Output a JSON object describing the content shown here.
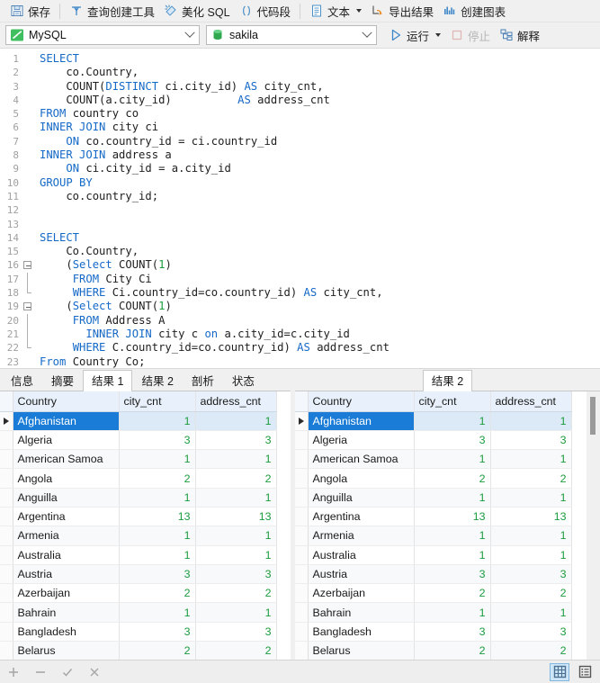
{
  "toolbar": {
    "items": [
      {
        "label": "保存",
        "icon": "save-icon",
        "disabled": false
      },
      {
        "label": "查询创建工具",
        "icon": "query-builder-icon",
        "disabled": false
      },
      {
        "label": "美化 SQL",
        "icon": "beautify-sql-icon",
        "disabled": false
      },
      {
        "label": "代码段",
        "icon": "code-snippet-icon",
        "disabled": false
      },
      {
        "label": "文本",
        "icon": "text-icon",
        "disabled": false
      },
      {
        "label": "导出结果",
        "icon": "export-result-icon",
        "disabled": false
      },
      {
        "label": "创建图表",
        "icon": "create-chart-icon",
        "disabled": false
      }
    ]
  },
  "connection_bar": {
    "connection": {
      "value": "MySQL",
      "icon": "mysql-icon"
    },
    "database": {
      "value": "sakila",
      "icon": "database-icon"
    },
    "run_label": "运行",
    "stop_label": "停止",
    "explain_label": "解释"
  },
  "editor": {
    "lines": [
      {
        "n": 1,
        "html": "<span class='kw'>SELECT</span>"
      },
      {
        "n": 2,
        "html": "    co.Country,"
      },
      {
        "n": 3,
        "html": "    COUNT(<span class='kw'>DISTINCT</span> ci.city_id) <span class='kw'>AS</span> city_cnt,"
      },
      {
        "n": 4,
        "html": "    COUNT(a.city_id)          <span class='kw'>AS</span> address_cnt"
      },
      {
        "n": 5,
        "html": "<span class='kw'>FROM</span> country co"
      },
      {
        "n": 6,
        "html": "<span class='kw'>INNER JOIN</span> city ci"
      },
      {
        "n": 7,
        "html": "    <span class='kw'>ON</span> co.country_id = ci.country_id"
      },
      {
        "n": 8,
        "html": "<span class='kw'>INNER JOIN</span> address a"
      },
      {
        "n": 9,
        "html": "    <span class='kw'>ON</span> ci.city_id = a.city_id"
      },
      {
        "n": 10,
        "html": "<span class='kw'>GROUP BY</span>"
      },
      {
        "n": 11,
        "html": "    co.country_id;"
      },
      {
        "n": 12,
        "html": ""
      },
      {
        "n": 13,
        "html": ""
      },
      {
        "n": 14,
        "html": "<span class='kw'>SELECT</span>"
      },
      {
        "n": 15,
        "html": "    Co.Country,"
      },
      {
        "n": 16,
        "html": "    (<span class='kw'>Select</span> COUNT(<span class='num'>1</span>)",
        "fold": "start"
      },
      {
        "n": 17,
        "html": "     <span class='kw'>FROM</span> City Ci",
        "fold": "mid"
      },
      {
        "n": 18,
        "html": "     <span class='kw'>WHERE</span> Ci.country_id=co.country_id) <span class='kw'>AS</span> city_cnt,",
        "fold": "end"
      },
      {
        "n": 19,
        "html": "    (<span class='kw'>Select</span> COUNT(<span class='num'>1</span>)",
        "fold": "start"
      },
      {
        "n": 20,
        "html": "     <span class='kw'>FROM</span> Address A",
        "fold": "mid"
      },
      {
        "n": 21,
        "html": "       <span class='kw'>INNER JOIN</span> city c <span class='kw'>on</span> a.city_id=c.city_id",
        "fold": "mid"
      },
      {
        "n": 22,
        "html": "     <span class='kw'>WHERE</span> C.country_id=co.country_id) <span class='kw'>AS</span> address_cnt",
        "fold": "end"
      },
      {
        "n": 23,
        "html": "<span class='kw'>From</span> Country Co;"
      }
    ]
  },
  "left_pane": {
    "tabs": [
      {
        "label": "信息",
        "active": false
      },
      {
        "label": "摘要",
        "active": false
      },
      {
        "label": "结果 1",
        "active": true
      },
      {
        "label": "结果 2",
        "active": false
      },
      {
        "label": "剖析",
        "active": false
      },
      {
        "label": "状态",
        "active": false
      }
    ],
    "grid": {
      "columns": [
        "Country",
        "city_cnt",
        "address_cnt"
      ],
      "rows": [
        {
          "country": "Afghanistan",
          "city_cnt": "1",
          "address_cnt": "1",
          "selected": true
        },
        {
          "country": "Algeria",
          "city_cnt": "3",
          "address_cnt": "3",
          "selected": false
        },
        {
          "country": "American Samoa",
          "city_cnt": "1",
          "address_cnt": "1",
          "selected": false
        },
        {
          "country": "Angola",
          "city_cnt": "2",
          "address_cnt": "2",
          "selected": false
        },
        {
          "country": "Anguilla",
          "city_cnt": "1",
          "address_cnt": "1",
          "selected": false
        },
        {
          "country": "Argentina",
          "city_cnt": "13",
          "address_cnt": "13",
          "selected": false
        },
        {
          "country": "Armenia",
          "city_cnt": "1",
          "address_cnt": "1",
          "selected": false
        },
        {
          "country": "Australia",
          "city_cnt": "1",
          "address_cnt": "1",
          "selected": false
        },
        {
          "country": "Austria",
          "city_cnt": "3",
          "address_cnt": "3",
          "selected": false
        },
        {
          "country": "Azerbaijan",
          "city_cnt": "2",
          "address_cnt": "2",
          "selected": false
        },
        {
          "country": "Bahrain",
          "city_cnt": "1",
          "address_cnt": "1",
          "selected": false
        },
        {
          "country": "Bangladesh",
          "city_cnt": "3",
          "address_cnt": "3",
          "selected": false
        },
        {
          "country": "Belarus",
          "city_cnt": "2",
          "address_cnt": "2",
          "selected": false
        }
      ]
    }
  },
  "right_pane": {
    "tabs": [
      {
        "label": "结果 2",
        "active": true
      }
    ],
    "grid": {
      "columns": [
        "Country",
        "city_cnt",
        "address_cnt"
      ],
      "rows": [
        {
          "country": "Afghanistan",
          "city_cnt": "1",
          "address_cnt": "1",
          "selected": true
        },
        {
          "country": "Algeria",
          "city_cnt": "3",
          "address_cnt": "3",
          "selected": false
        },
        {
          "country": "American Samoa",
          "city_cnt": "1",
          "address_cnt": "1",
          "selected": false
        },
        {
          "country": "Angola",
          "city_cnt": "2",
          "address_cnt": "2",
          "selected": false
        },
        {
          "country": "Anguilla",
          "city_cnt": "1",
          "address_cnt": "1",
          "selected": false
        },
        {
          "country": "Argentina",
          "city_cnt": "13",
          "address_cnt": "13",
          "selected": false
        },
        {
          "country": "Armenia",
          "city_cnt": "1",
          "address_cnt": "1",
          "selected": false
        },
        {
          "country": "Australia",
          "city_cnt": "1",
          "address_cnt": "1",
          "selected": false
        },
        {
          "country": "Austria",
          "city_cnt": "3",
          "address_cnt": "3",
          "selected": false
        },
        {
          "country": "Azerbaijan",
          "city_cnt": "2",
          "address_cnt": "2",
          "selected": false
        },
        {
          "country": "Bahrain",
          "city_cnt": "1",
          "address_cnt": "1",
          "selected": false
        },
        {
          "country": "Bangladesh",
          "city_cnt": "3",
          "address_cnt": "3",
          "selected": false
        },
        {
          "country": "Belarus",
          "city_cnt": "2",
          "address_cnt": "2",
          "selected": false
        }
      ]
    }
  },
  "statusbar": {
    "add": "+",
    "remove": "−",
    "confirm": "✓",
    "cancel": "✕",
    "grid_view_icon": "grid-view-icon",
    "form_view_icon": "form-view-icon"
  },
  "colors": {
    "accent": "#1a7cd6",
    "keyword": "#1569c7",
    "number": "#1a9c3c",
    "header_bg": "#e8f1fb",
    "chrome_bg": "#f0f0f0"
  }
}
